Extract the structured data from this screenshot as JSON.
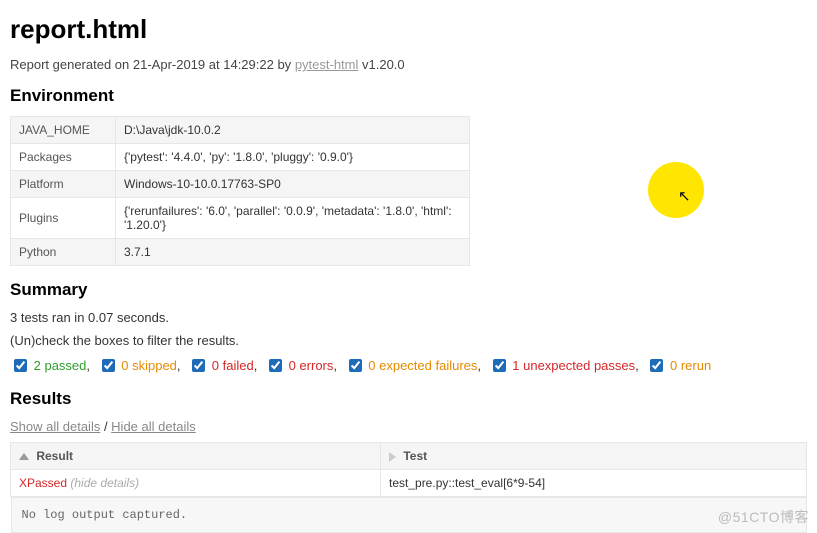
{
  "title": "report.html",
  "generated": {
    "prefix": "Report generated on ",
    "date": "21-Apr-2019",
    "at_literal": " at ",
    "time": "14:29:22",
    "by_literal": " by ",
    "tool_link": "pytest-html",
    "tool_version": " v1.20.0"
  },
  "env_heading": "Environment",
  "env_rows": [
    {
      "k": "JAVA_HOME",
      "v": "D:\\Java\\jdk-10.0.2"
    },
    {
      "k": "Packages",
      "v": "{'pytest': '4.4.0', 'py': '1.8.0', 'pluggy': '0.9.0'}"
    },
    {
      "k": "Platform",
      "v": "Windows-10-10.0.17763-SP0"
    },
    {
      "k": "Plugins",
      "v": "{'rerunfailures': '6.0', 'parallel': '0.0.9', 'metadata': '1.8.0', 'html': '1.20.0'}"
    },
    {
      "k": "Python",
      "v": "3.7.1"
    }
  ],
  "summary_heading": "Summary",
  "summary_line": "3 tests ran in 0.07 seconds.",
  "filter_hint": "(Un)check the boxes to filter the results.",
  "filters": {
    "passed": "2 passed",
    "skipped": "0 skipped",
    "failed": "0 failed",
    "errors": "0 errors",
    "xfail": "0 expected failures",
    "xpass": "1 unexpected passes",
    "rerun": "0 rerun"
  },
  "results_heading": "Results",
  "toggles": {
    "show": "Show all details",
    "sep": " / ",
    "hide": "Hide all details"
  },
  "columns": {
    "result": "Result",
    "test": "Test"
  },
  "rows": [
    {
      "result": "XPassed",
      "hide": "(hide details)",
      "test": "test_pre.py::test_eval[6*9-54]"
    }
  ],
  "log_output": "No log output captured.",
  "watermark": "@51CTO博客"
}
